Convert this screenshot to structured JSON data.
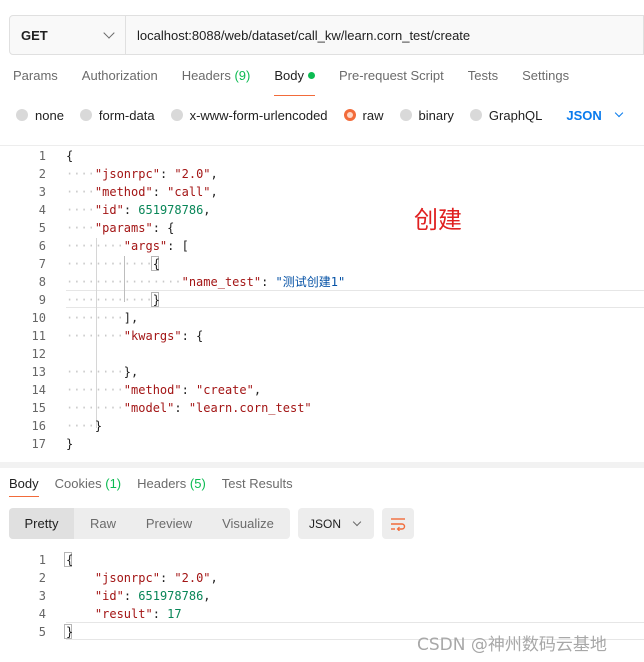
{
  "request": {
    "method": "GET",
    "url": "localhost:8088/web/dataset/call_kw/learn.corn_test/create"
  },
  "request_tabs": [
    {
      "label": "Params"
    },
    {
      "label": "Authorization"
    },
    {
      "label": "Headers",
      "count": "(9)"
    },
    {
      "label": "Body"
    },
    {
      "label": "Pre-request Script"
    },
    {
      "label": "Tests"
    },
    {
      "label": "Settings"
    }
  ],
  "body_types": [
    "none",
    "form-data",
    "x-www-form-urlencoded",
    "raw",
    "binary",
    "GraphQL"
  ],
  "body_format": "JSON",
  "request_body_lines": [
    {
      "n": "1"
    },
    {
      "n": "2"
    },
    {
      "n": "3"
    },
    {
      "n": "4"
    },
    {
      "n": "5"
    },
    {
      "n": "6"
    },
    {
      "n": "7"
    },
    {
      "n": "8"
    },
    {
      "n": "9"
    },
    {
      "n": "10"
    },
    {
      "n": "11"
    },
    {
      "n": "12"
    },
    {
      "n": "13"
    },
    {
      "n": "14"
    },
    {
      "n": "15"
    },
    {
      "n": "16"
    },
    {
      "n": "17"
    }
  ],
  "request_body": {
    "jsonrpc_key": "\"jsonrpc\"",
    "jsonrpc_val": "\"2.0\"",
    "method_key": "\"method\"",
    "method_val": "\"call\"",
    "id_key": "\"id\"",
    "id_val": "651978786",
    "params_key": "\"params\"",
    "args_key": "\"args\"",
    "name_key": "\"name_test\"",
    "name_val": "\"测试创建1\"",
    "kwargs_key": "\"kwargs\"",
    "inner_method_key": "\"method\"",
    "inner_method_val": "\"create\"",
    "model_key": "\"model\"",
    "model_val": "\"learn.corn_test\""
  },
  "annotation": "创建",
  "response_tabs": [
    {
      "label": "Body"
    },
    {
      "label": "Cookies",
      "count": "(1)"
    },
    {
      "label": "Headers",
      "count": "(5)"
    },
    {
      "label": "Test Results"
    }
  ],
  "view_modes": [
    "Pretty",
    "Raw",
    "Preview",
    "Visualize"
  ],
  "response_format": "JSON",
  "response_body": {
    "jsonrpc_key": "\"jsonrpc\"",
    "jsonrpc_val": "\"2.0\"",
    "id_key": "\"id\"",
    "id_val": "651978786",
    "result_key": "\"result\"",
    "result_val": "17"
  },
  "response_line_numbers": [
    "1",
    "2",
    "3",
    "4",
    "5"
  ],
  "watermark": "CSDN @神州数码云基地",
  "colors": {
    "accent": "#f26b3a",
    "link": "#097bed",
    "success": "#0cbb52",
    "annotation": "#e02020"
  }
}
